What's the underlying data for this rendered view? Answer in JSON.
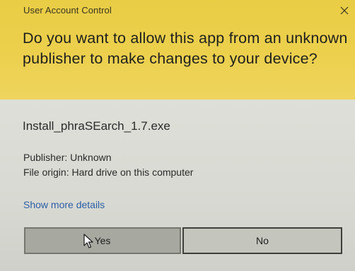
{
  "window": {
    "title": "User Account Control"
  },
  "prompt": {
    "question": "Do you want to allow this app from an unknown publisher to make changes to your device?"
  },
  "app": {
    "file_name": "Install_phraSEarch_1.7.exe",
    "publisher": "Publisher: Unknown",
    "origin": "File origin: Hard drive on this computer",
    "more_details_link": "Show more details"
  },
  "buttons": {
    "yes": "Yes",
    "no": "No"
  },
  "colors": {
    "header_bg": "#ecd04d",
    "body_bg": "#d9d9d2",
    "link": "#2c5fa8"
  },
  "icons": {
    "close": "close-icon",
    "cursor": "mouse-pointer-icon"
  }
}
